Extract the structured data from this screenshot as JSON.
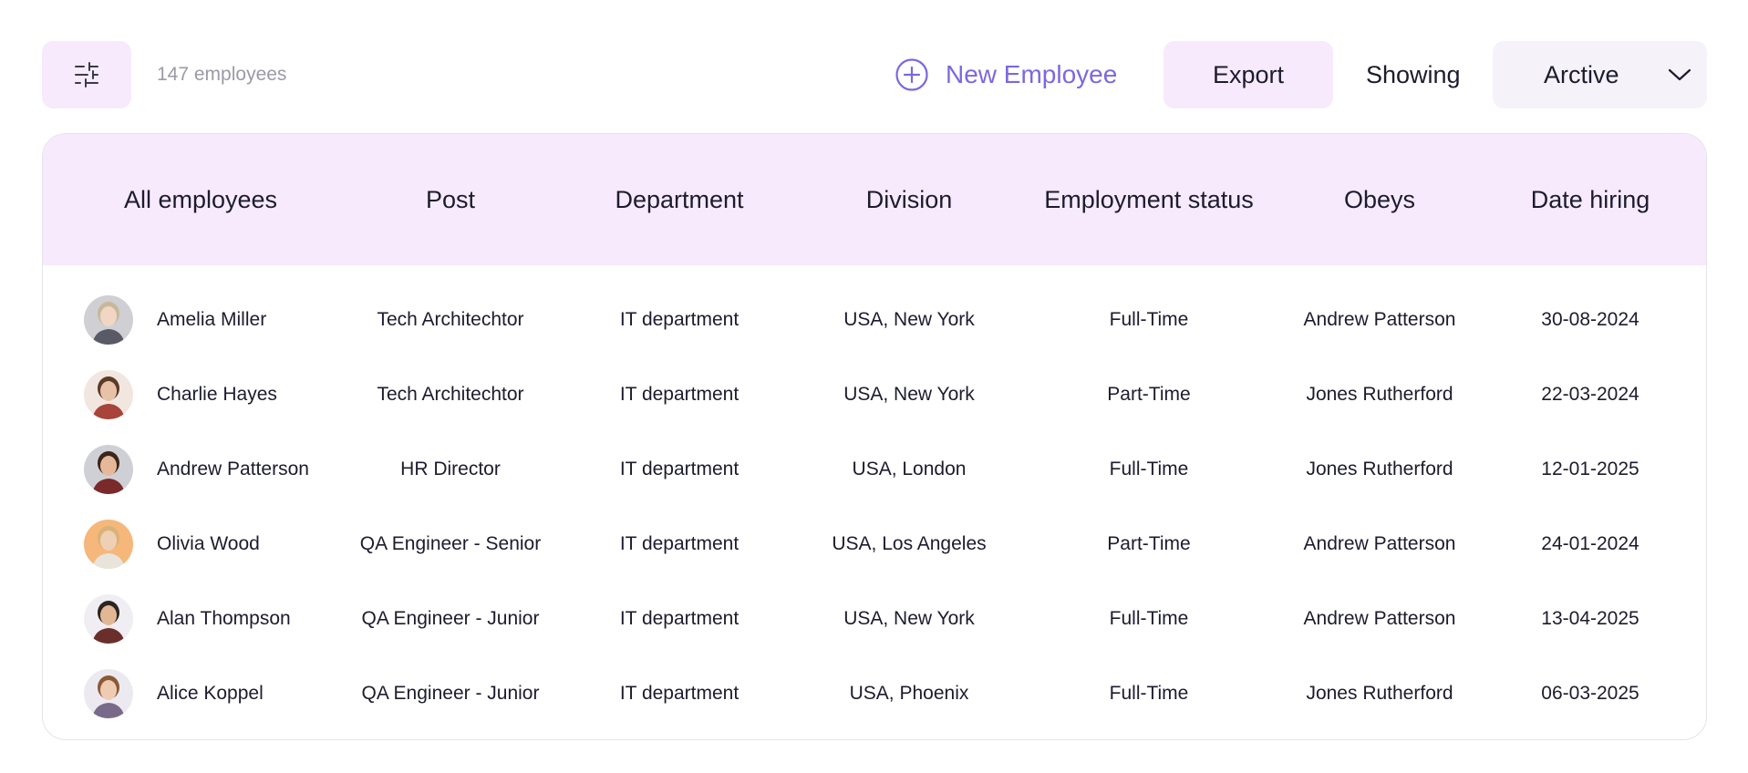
{
  "toolbar": {
    "filter_icon": "sliders-icon",
    "count_label": "147 employees",
    "new_employee_label": "New Employee",
    "new_employee_icon": "plus-circle-icon",
    "export_label": "Export",
    "showing_label": "Showing",
    "status_select_value": "Arctive",
    "status_select_icon": "chevron-down-icon"
  },
  "table": {
    "columns": [
      "All employees",
      "Post",
      "Department",
      "Division",
      "Employment status",
      "Obeys",
      "Date hiring"
    ],
    "rows": [
      {
        "name": "Amelia Miller",
        "post": "Tech Architechtor",
        "department": "IT department",
        "division": "USA, New York",
        "status": "Full-Time",
        "obeys": "Andrew Patterson",
        "date": "30-08-2024"
      },
      {
        "name": "Charlie Hayes",
        "post": "Tech Architechtor",
        "department": "IT department",
        "division": "USA, New York",
        "status": "Part-Time",
        "obeys": "Jones Rutherford",
        "date": "22-03-2024"
      },
      {
        "name": "Andrew Patterson",
        "post": "HR Director",
        "department": "IT department",
        "division": "USA, London",
        "status": "Full-Time",
        "obeys": "Jones Rutherford",
        "date": "12-01-2025"
      },
      {
        "name": "Olivia Wood",
        "post": "QA Engineer - Senior",
        "department": "IT department",
        "division": "USA, Los Angeles",
        "status": "Part-Time",
        "obeys": "Andrew Patterson",
        "date": "24-01-2024"
      },
      {
        "name": "Alan Thompson",
        "post": "QA Engineer - Junior",
        "department": "IT department",
        "division": "USA, New York",
        "status": "Full-Time",
        "obeys": "Andrew Patterson",
        "date": "13-04-2025"
      },
      {
        "name": "Alice Koppel",
        "post": "QA Engineer - Junior",
        "department": "IT department",
        "division": "USA, Phoenix",
        "status": "Full-Time",
        "obeys": "Jones Rutherford",
        "date": "06-03-2025"
      }
    ]
  },
  "colors": {
    "accent": "#7b68e0",
    "header_bg": "#f7eafc",
    "select_bg": "#f5f3f9",
    "muted_text": "#9a9aa8"
  }
}
